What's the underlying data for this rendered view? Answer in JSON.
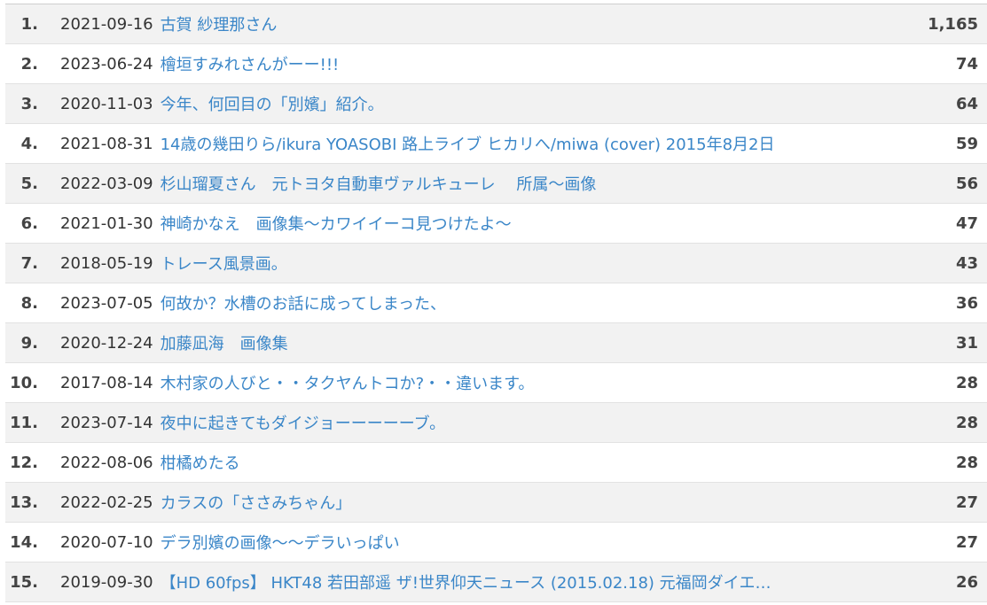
{
  "ranking": {
    "rows": [
      {
        "rank": "1.",
        "date": "2021-09-16",
        "title": "古賀 紗理那さん",
        "count": "1,165"
      },
      {
        "rank": "2.",
        "date": "2023-06-24",
        "title": "檜垣すみれさんがーー!!!",
        "count": "74"
      },
      {
        "rank": "3.",
        "date": "2020-11-03",
        "title": "今年、何回目の「別嬪」紹介。",
        "count": "64"
      },
      {
        "rank": "4.",
        "date": "2021-08-31",
        "title": "14歳の幾田りら/ikura YOASOBI 路上ライブ ヒカリへ/miwa (cover) 2015年8月2日",
        "count": "59"
      },
      {
        "rank": "5.",
        "date": "2022-03-09",
        "title": "杉山瑠夏さん　元トヨタ自動車ヴァルキューレ　 所属～画像",
        "count": "56"
      },
      {
        "rank": "6.",
        "date": "2021-01-30",
        "title": "神崎かなえ　画像集～カワイイーコ見つけたよ～",
        "count": "47"
      },
      {
        "rank": "7.",
        "date": "2018-05-19",
        "title": "トレース風景画。",
        "count": "43"
      },
      {
        "rank": "8.",
        "date": "2023-07-05",
        "title": "何故か？水槽のお話に成ってしまった、",
        "count": "36"
      },
      {
        "rank": "9.",
        "date": "2020-12-24",
        "title": "加藤凪海　画像集",
        "count": "31"
      },
      {
        "rank": "10.",
        "date": "2017-08-14",
        "title": "木村家の人びと・・タクヤんトコか?・・違います。",
        "count": "28"
      },
      {
        "rank": "11.",
        "date": "2023-07-14",
        "title": "夜中に起きてもダイジョーーーーーブ。",
        "count": "28"
      },
      {
        "rank": "12.",
        "date": "2022-08-06",
        "title": "柑橘めたる",
        "count": "28"
      },
      {
        "rank": "13.",
        "date": "2022-02-25",
        "title": "カラスの「ささみちゃん」",
        "count": "27"
      },
      {
        "rank": "14.",
        "date": "2020-07-10",
        "title": "デラ別嬪の画像～～デラいっぱい",
        "count": "27"
      },
      {
        "rank": "15.",
        "date": "2019-09-30",
        "title": "【HD 60fps】 HKT48 若田部遥 ザ!世界仰天ニュース (2015.02.18) 元福岡ダイエ…",
        "count": "26"
      }
    ]
  },
  "colors": {
    "link": "#3a86c8",
    "row_alt": "#f2f2f2",
    "text": "#333333"
  }
}
